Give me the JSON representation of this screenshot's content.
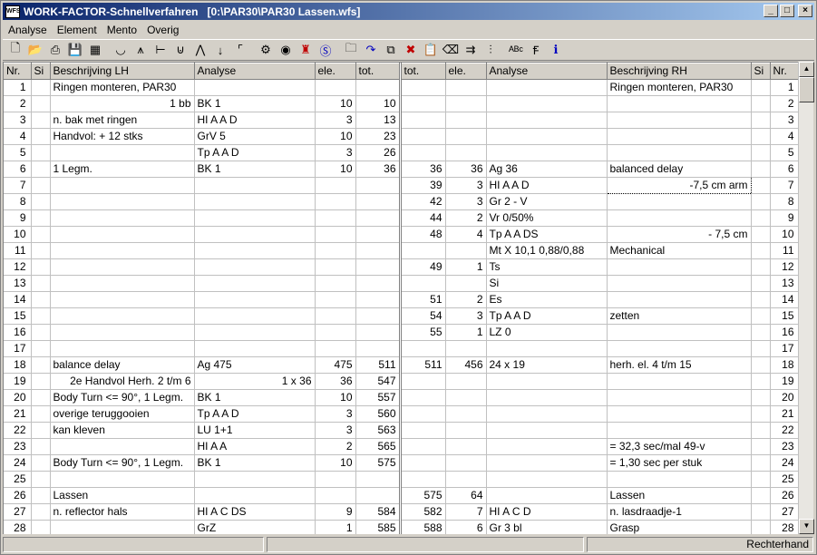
{
  "window": {
    "title": "WORK-FACTOR-Schnellverfahren   [0:\\PAR30\\PAR30 Lassen.wfs]",
    "icon_label": "WFS",
    "minimize": "_",
    "maximize": "□",
    "close": "×"
  },
  "menu": [
    "Analyse",
    "Element",
    "Mento",
    "Overig"
  ],
  "toolbar": [
    "new-icon",
    "open-icon",
    "print-icon",
    "save-icon",
    "calculator-icon",
    "sep",
    "curve-icon",
    "tree-icon",
    "tee-icon",
    "cup-icon",
    "caret-icon",
    "down-arrow-icon",
    "corner-icon",
    "sep",
    "gear-icon",
    "eye-icon",
    "figure-icon",
    "circle-s-icon",
    "sep",
    "folder-icon",
    "redo-icon",
    "copy-icon",
    "cut-icon",
    "paste-icon",
    "delete-icon",
    "insert-icon",
    "align-icon",
    "sep",
    "spellcheck-icon",
    "font-icon",
    "info-icon"
  ],
  "columns": {
    "nr": "Nr.",
    "si": "Si",
    "desc_lh": "Beschrijving LH",
    "analyse_lh": "Analyse",
    "ele_lh": "ele.",
    "tot_lh": "tot.",
    "tot_rh": "tot.",
    "ele_rh": "ele.",
    "analyse_rh": "Analyse",
    "desc_rh": "Beschrijving RH",
    "si_rh": "Si",
    "nr_rh": "Nr."
  },
  "rows": [
    {
      "nr": "1",
      "dl": "Ringen monteren, PAR30",
      "al": "",
      "el": "",
      "tl": "",
      "tr": "",
      "er": "",
      "ar": "",
      "dr": "Ringen monteren, PAR30"
    },
    {
      "nr": "2",
      "dl": "1 bb",
      "dlr": true,
      "al": "BK 1",
      "el": "10",
      "tl": "10",
      "tr": "",
      "er": "",
      "ar": "",
      "dr": ""
    },
    {
      "nr": "3",
      "dl": "n. bak met ringen",
      "al": "HI A A D",
      "el": "3",
      "tl": "13",
      "tr": "",
      "er": "",
      "ar": "",
      "dr": ""
    },
    {
      "nr": "4",
      "dl": "Handvol: + 12 stks",
      "al": "GrV 5",
      "el": "10",
      "tl": "23",
      "tr": "",
      "er": "",
      "ar": "",
      "dr": ""
    },
    {
      "nr": "5",
      "dl": "",
      "al": "Tp A A D",
      "el": "3",
      "tl": "26",
      "tr": "",
      "er": "",
      "ar": "",
      "dr": ""
    },
    {
      "nr": "6",
      "dl": " 1 Legm.",
      "al": "BK 1",
      "el": "10",
      "tl": "36",
      "tr": "36",
      "er": "36",
      "ar": "Ag 36",
      "dr": "balanced delay"
    },
    {
      "nr": "7",
      "dl": "",
      "al": "",
      "el": "",
      "tl": "",
      "tr": "39",
      "er": "3",
      "ar": "HI A A D",
      "dr": "-7,5 cm arm",
      "drr": true,
      "sel": true
    },
    {
      "nr": "8",
      "dl": "",
      "al": "",
      "el": "",
      "tl": "",
      "tr": "42",
      "er": "3",
      "ar": "Gr  2 - V",
      "dr": ""
    },
    {
      "nr": "9",
      "dl": "",
      "al": "",
      "el": "",
      "tl": "",
      "tr": "44",
      "er": "2",
      "ar": "Vr 0/50%",
      "dr": ""
    },
    {
      "nr": "10",
      "dl": "",
      "al": "",
      "el": "",
      "tl": "",
      "tr": "48",
      "er": "4",
      "ar": "Tp A A DS",
      "dr": "- 7,5 cm",
      "drr": true
    },
    {
      "nr": "11",
      "dl": "",
      "al": "",
      "el": "",
      "tl": "",
      "tr": "",
      "er": "",
      "ar": "Mt X 10,1 0,88/0,88",
      "dr": "Mechanical"
    },
    {
      "nr": "12",
      "dl": "",
      "al": "",
      "el": "",
      "tl": "",
      "tr": "49",
      "er": "1",
      "ar": "Ts",
      "dr": ""
    },
    {
      "nr": "13",
      "dl": "",
      "al": "",
      "el": "",
      "tl": "",
      "tr": "",
      "er": "",
      "ar": "Si",
      "dr": ""
    },
    {
      "nr": "14",
      "dl": "",
      "al": "",
      "el": "",
      "tl": "",
      "tr": "51",
      "er": "2",
      "ar": "Es",
      "dr": ""
    },
    {
      "nr": "15",
      "dl": "",
      "al": "",
      "el": "",
      "tl": "",
      "tr": "54",
      "er": "3",
      "ar": "Tp A A D",
      "dr": "zetten"
    },
    {
      "nr": "16",
      "dl": "",
      "al": "",
      "el": "",
      "tl": "",
      "tr": "55",
      "er": "1",
      "ar": "LZ 0",
      "dr": ""
    },
    {
      "nr": "17",
      "dl": "",
      "al": "",
      "el": "",
      "tl": "",
      "tr": "",
      "er": "",
      "ar": "",
      "dr": ""
    },
    {
      "nr": "18",
      "dl": "balance delay",
      "al": "Ag 475",
      "el": "475",
      "tl": "511",
      "tr": "511",
      "er": "456",
      "ar": " 24 x 19",
      "dr": "herh. el. 4 t/m 15"
    },
    {
      "nr": "19",
      "dl": "2e Handvol Herh. 2 t/m 6",
      "dlr": true,
      "al": "1 x 36",
      "alr": true,
      "el": "36",
      "tl": "547",
      "tr": "",
      "er": "",
      "ar": "",
      "dr": ""
    },
    {
      "nr": "20",
      "dl": "Body Turn <= 90°, 1 Legm.",
      "al": "BK 1",
      "el": "10",
      "tl": "557",
      "tr": "",
      "er": "",
      "ar": "",
      "dr": ""
    },
    {
      "nr": "21",
      "dl": "overige teruggooien",
      "al": "Tp A A D",
      "el": "3",
      "tl": "560",
      "tr": "",
      "er": "",
      "ar": "",
      "dr": ""
    },
    {
      "nr": "22",
      "dl": "kan kleven",
      "al": "LU 1+1",
      "el": "3",
      "tl": "563",
      "tr": "",
      "er": "",
      "ar": "",
      "dr": ""
    },
    {
      "nr": "23",
      "dl": "",
      "al": "HI A A",
      "el": "2",
      "tl": "565",
      "tr": "",
      "er": "",
      "ar": "",
      "dr": "= 32,3 sec/mal 49-v"
    },
    {
      "nr": "24",
      "dl": "Body Turn <= 90°, 1 Legm.",
      "al": "BK 1",
      "el": "10",
      "tl": "575",
      "tr": "",
      "er": "",
      "ar": "",
      "dr": "= 1,30 sec per stuk"
    },
    {
      "nr": "25",
      "dl": "",
      "al": "",
      "el": "",
      "tl": "",
      "tr": "",
      "er": "",
      "ar": "",
      "dr": ""
    },
    {
      "nr": "26",
      "dl": "Lassen",
      "al": "",
      "el": "",
      "tl": "",
      "tr": "575",
      "er": "64",
      "ar": "",
      "dr": "Lassen"
    },
    {
      "nr": "27",
      "dl": "n. reflector hals",
      "al": "HI A C DS",
      "el": "9",
      "tl": "584",
      "tr": "582",
      "er": "7",
      "ar": "HI A C D",
      "dr": "n. lasdraadje-1"
    },
    {
      "nr": "28",
      "dl": "",
      "al": "GrZ",
      "el": "1",
      "tl": "585",
      "tr": "588",
      "er": "6",
      "ar": "Gr  3 bl",
      "dr": "Grasp"
    }
  ],
  "status": {
    "panel1": "",
    "panel2": "",
    "panel3": "Rechterhand"
  }
}
